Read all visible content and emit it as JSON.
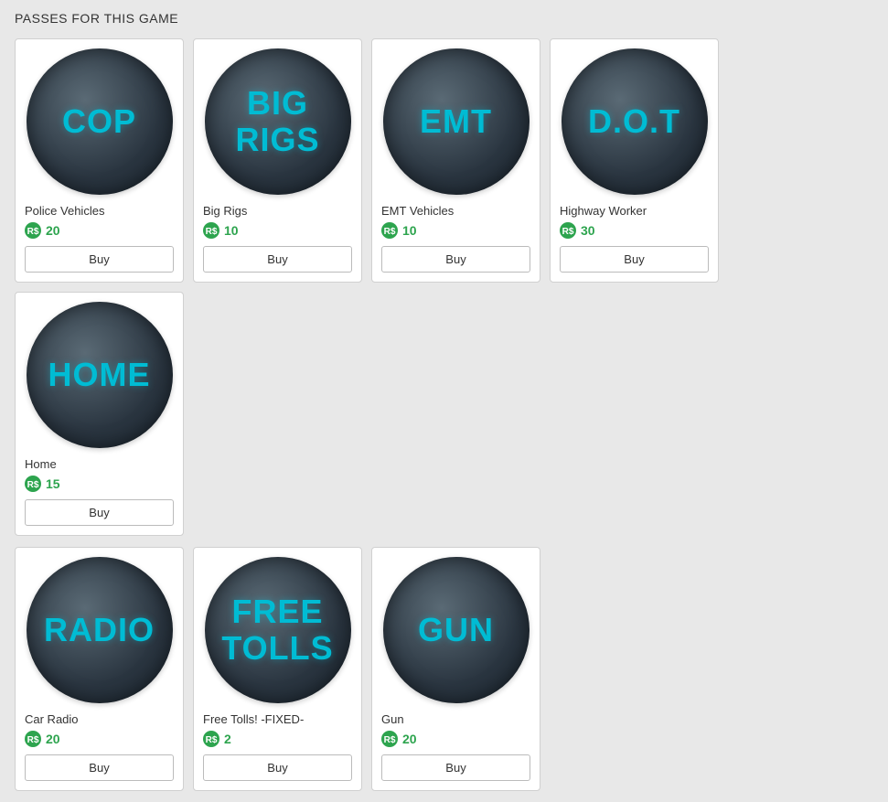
{
  "page": {
    "title": "PASSES FOR THIS GAME"
  },
  "passes_row1": [
    {
      "id": "cop",
      "icon_text": "COP",
      "name": "Police Vehicles",
      "price": 20,
      "buy_label": "Buy"
    },
    {
      "id": "big-rigs",
      "icon_text": "BIG\nRIGS",
      "name": "Big Rigs",
      "price": 10,
      "buy_label": "Buy"
    },
    {
      "id": "emt",
      "icon_text": "EMT",
      "name": "EMT Vehicles",
      "price": 10,
      "buy_label": "Buy"
    },
    {
      "id": "dot",
      "icon_text": "D.O.T",
      "name": "Highway Worker",
      "price": 30,
      "buy_label": "Buy"
    },
    {
      "id": "home",
      "icon_text": "HOME",
      "name": "Home",
      "price": 15,
      "buy_label": "Buy"
    }
  ],
  "passes_row2": [
    {
      "id": "radio",
      "icon_text": "RADIO",
      "name": "Car Radio",
      "price": 20,
      "buy_label": "Buy"
    },
    {
      "id": "free-tolls",
      "icon_text": "FREE\nTOLLS",
      "name": "Free Tolls! -FIXED-",
      "price": 2,
      "buy_label": "Buy"
    },
    {
      "id": "gun",
      "icon_text": "GUN",
      "name": "Gun",
      "price": 20,
      "buy_label": "Buy"
    }
  ]
}
